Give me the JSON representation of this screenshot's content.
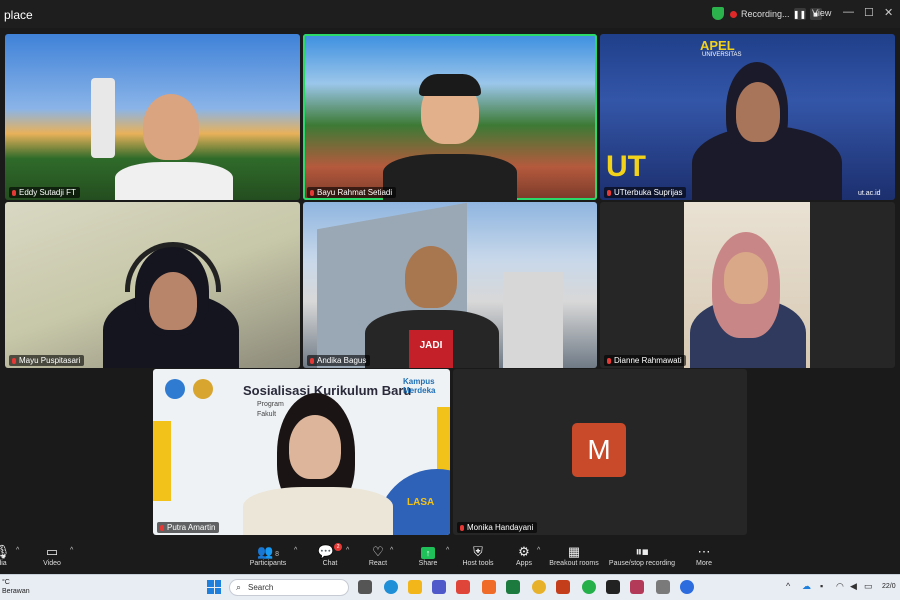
{
  "window": {
    "title": "place",
    "recording_label": "Recording...",
    "view_label": "View"
  },
  "participants": [
    {
      "name": "Eddy Sutadji FT",
      "active": false
    },
    {
      "name": "Bayu Rahmat Setiadi",
      "active": true
    },
    {
      "name": "UTterbuka Suprijas",
      "active": false,
      "banner": "APEL",
      "banner_sub": "UNIVERSITAS",
      "logo_text": "UT",
      "footer_text": "ut.ac.id"
    },
    {
      "name": "Mayu Puspitasari",
      "active": false
    },
    {
      "name": "Andika Bagus",
      "active": false,
      "shirt_text": "JADI"
    },
    {
      "name": "Dianne Rahmawati",
      "active": false
    },
    {
      "name": "Putra Amartin",
      "active": false
    },
    {
      "name": "Monika Handayani",
      "active": false,
      "initial": "M"
    }
  ],
  "slide": {
    "title": "Sosialisasi Kurikulum Baru",
    "line1": "Program",
    "line2": "Fakult",
    "brand": "Kampus Merdeka",
    "circle_text": "LASA"
  },
  "toolbar": {
    "audio_label": "dia",
    "video_label": "Video",
    "participants_label": "Participants",
    "participants_count": "8",
    "chat_label": "Chat",
    "chat_badge": "2",
    "react_label": "React",
    "share_label": "Share",
    "host_tools_label": "Host tools",
    "apps_label": "Apps",
    "breakout_label": "Breakout rooms",
    "recording_label": "Pause/stop recording",
    "more_label": "More"
  },
  "taskbar": {
    "weather_temp": "°C",
    "weather_desc": "Berawan",
    "search_placeholder": "Search",
    "date": "22/0"
  },
  "colors": {
    "active_border": "#2bd96b",
    "share_green": "#1fbf5a",
    "recording_red": "#e02828",
    "avatar_m": "#c84a2a"
  }
}
